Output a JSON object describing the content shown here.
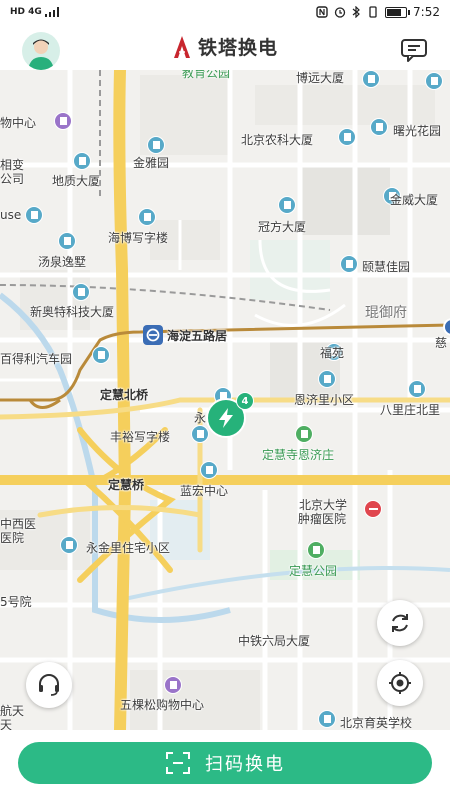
{
  "status_bar": {
    "left_text": "HD 4G",
    "time": "7:52",
    "battery_level": 0.85
  },
  "header": {
    "title": "铁塔换电",
    "logo_icon": "tower-logo-icon",
    "avatar_icon": "user-avatar-icon",
    "message_icon": "message-icon"
  },
  "map": {
    "labels": [
      {
        "text": "教育公园",
        "cls": "green"
      },
      {
        "text": "博远大厦",
        "cls": ""
      },
      {
        "text": "物中心",
        "cls": ""
      },
      {
        "text": "曙光花园",
        "cls": ""
      },
      {
        "text": "北京农科大厦",
        "cls": ""
      },
      {
        "text": "相变",
        "cls": ""
      },
      {
        "text": "公司",
        "cls": ""
      },
      {
        "text": "金雅园",
        "cls": ""
      },
      {
        "text": "地质大厦",
        "cls": ""
      },
      {
        "text": "金威大厦",
        "cls": ""
      },
      {
        "text": "use",
        "cls": ""
      },
      {
        "text": "冠方大厦",
        "cls": ""
      },
      {
        "text": "海博写字楼",
        "cls": ""
      },
      {
        "text": "汤泉逸墅",
        "cls": ""
      },
      {
        "text": "颐慧佳园",
        "cls": ""
      },
      {
        "text": "新奥特科技大厦",
        "cls": ""
      },
      {
        "text": "琨御府",
        "cls": "district"
      },
      {
        "text": "海淀五路居",
        "cls": "bold"
      },
      {
        "text": "慈",
        "cls": ""
      },
      {
        "text": "百得利汽车园",
        "cls": ""
      },
      {
        "text": "福苑",
        "cls": ""
      },
      {
        "text": "定慧北桥",
        "cls": "bold"
      },
      {
        "text": "恩济里小区",
        "cls": ""
      },
      {
        "text": "八里庄北里",
        "cls": ""
      },
      {
        "text": "永",
        "cls": ""
      },
      {
        "text": "丰裕写字楼",
        "cls": ""
      },
      {
        "text": "定慧寺恩济庄",
        "cls": "green"
      },
      {
        "text": "定慧桥",
        "cls": "bold"
      },
      {
        "text": "蓝宏中心",
        "cls": ""
      },
      {
        "text": "北京大学",
        "cls": ""
      },
      {
        "text": "肿瘤医院",
        "cls": ""
      },
      {
        "text": "中西医",
        "cls": ""
      },
      {
        "text": "医院",
        "cls": ""
      },
      {
        "text": "永金里住宅小区",
        "cls": ""
      },
      {
        "text": "定慧公园",
        "cls": "green"
      },
      {
        "text": "5号院",
        "cls": ""
      },
      {
        "text": "中铁六局大厦",
        "cls": ""
      },
      {
        "text": "航天",
        "cls": ""
      },
      {
        "text": "五棵松购物中心",
        "cls": ""
      },
      {
        "text": "北京育英学校",
        "cls": ""
      },
      {
        "text": "天",
        "cls": ""
      }
    ],
    "metro_station_icon": "metro-icon",
    "station_marker": {
      "icon": "charge-station-icon",
      "count": "4"
    },
    "buttons": {
      "refresh_icon": "refresh-icon",
      "locate_icon": "locate-icon",
      "service_icon": "headset-icon"
    }
  },
  "bottom": {
    "scan_label": "扫码换电",
    "scan_icon": "scan-icon"
  },
  "colors": {
    "accent": "#2cba86",
    "highway": "#f5cf5c",
    "metro_line": "#b98a3a"
  }
}
